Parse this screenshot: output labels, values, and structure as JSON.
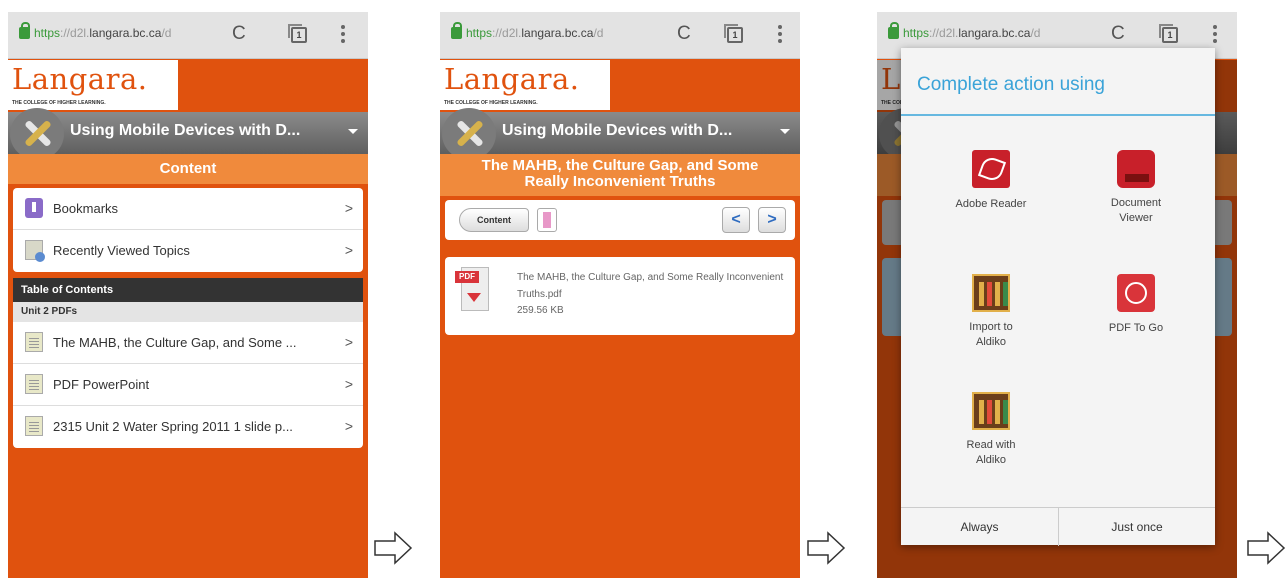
{
  "browser": {
    "url_https": "https",
    "url_sep": "://",
    "url_sub": "d2l.",
    "url_domain": "langara.bc.ca",
    "url_tail": "/d",
    "tab_count": "1"
  },
  "logo": {
    "name": "Langara.",
    "tagline": "THE COLLEGE OF HIGHER LEARNING."
  },
  "course_title": "Using Mobile Devices with D...",
  "screen1": {
    "section_title": "Content",
    "quick_links": [
      {
        "label": "Bookmarks"
      },
      {
        "label": "Recently Viewed Topics"
      }
    ],
    "toc_header": "Table of Contents",
    "unit_header": "Unit 2 PDFs",
    "items": [
      {
        "label": "The MAHB, the Culture Gap, and Some ..."
      },
      {
        "label": "PDF PowerPoint"
      },
      {
        "label": "2315 Unit 2 Water Spring 2011 1 slide p..."
      }
    ],
    "chevron": ">"
  },
  "screen2": {
    "topic_title_line1": "The MAHB, the Culture Gap, and Some",
    "topic_title_line2": "Really Inconvenient Truths",
    "content_button": "Content",
    "prev": "<",
    "next": ">",
    "file_badge": "PDF",
    "file_name": "The MAHB, the Culture Gap, and Some Really Inconvenient Truths.pdf",
    "file_size": "259.56 KB"
  },
  "screen3": {
    "dialog_title": "Complete action using",
    "apps": [
      {
        "label": "Adobe Reader",
        "icon": "adobe-reader-icon"
      },
      {
        "label": "Document Viewer",
        "icon": "document-viewer-icon"
      },
      {
        "label": "Import to Aldiko",
        "icon": "aldiko-icon"
      },
      {
        "label": "PDF To Go",
        "icon": "pdf-to-go-icon"
      },
      {
        "label": "Read with Aldiko",
        "icon": "aldiko-icon"
      }
    ],
    "always": "Always",
    "just_once": "Just once"
  }
}
